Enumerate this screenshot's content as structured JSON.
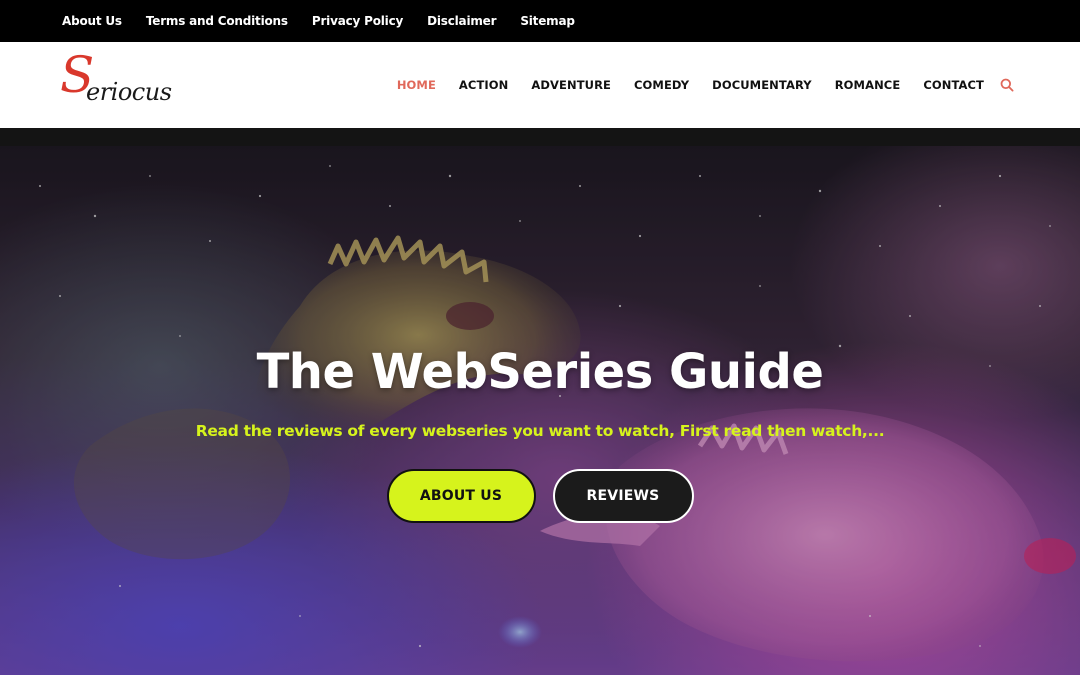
{
  "topbar": {
    "links": [
      {
        "label": "About Us"
      },
      {
        "label": "Terms and Conditions"
      },
      {
        "label": "Privacy Policy"
      },
      {
        "label": "Disclaimer"
      },
      {
        "label": "Sitemap"
      }
    ]
  },
  "header": {
    "logo": {
      "first_letter": "S",
      "rest": "eriocus"
    },
    "nav": [
      {
        "label": "HOME",
        "active": true
      },
      {
        "label": "ACTION"
      },
      {
        "label": "ADVENTURE"
      },
      {
        "label": "COMEDY"
      },
      {
        "label": "DOCUMENTARY"
      },
      {
        "label": "ROMANCE"
      },
      {
        "label": "CONTACT"
      }
    ],
    "search_icon": "search-icon"
  },
  "hero": {
    "title": "The WebSeries Guide",
    "subtitle": "Read the reviews of every webseries you want to watch, First read then watch,...",
    "primary_button": "ABOUT US",
    "secondary_button": "REVIEWS"
  },
  "colors": {
    "accent": "#e0685a",
    "lime": "#d6f31c",
    "topbar_bg": "#000000",
    "logo_red": "#d9382c"
  }
}
